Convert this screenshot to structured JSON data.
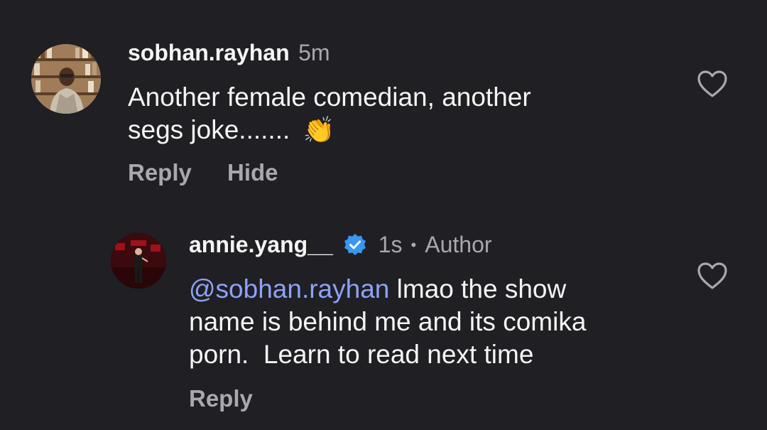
{
  "comments": [
    {
      "username": "sobhan.rayhan",
      "time": "5m",
      "text_line1": "Another female comedian, another",
      "text_line2": "segs joke.......",
      "emoji": "👏",
      "reply_label": "Reply",
      "hide_label": "Hide"
    },
    {
      "username": "annie.yang__",
      "verified": true,
      "time": "1s",
      "separator": "•",
      "role": "Author",
      "mention": "@sobhan.rayhan",
      "text_line1_rest": " lmao the show",
      "text_line2": "name is behind me and its comika",
      "text_line3": "porn.  Learn to read next time",
      "reply_label": "Reply"
    }
  ],
  "colors": {
    "background": "#1f1f24",
    "text": "#f5f5f5",
    "secondary": "#a8a8ad",
    "mention": "#8da2f5",
    "verified": "#3897f0"
  },
  "icons": [
    "heart-icon",
    "verified-badge-icon"
  ]
}
